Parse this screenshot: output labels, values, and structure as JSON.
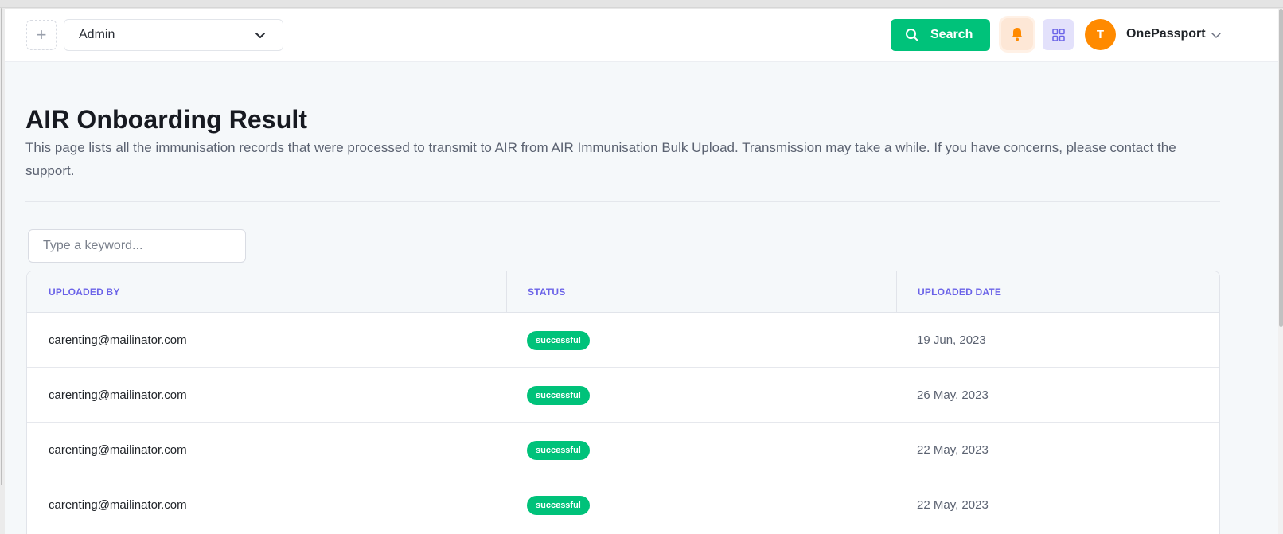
{
  "header": {
    "add_icon": "plus-icon",
    "role_select": {
      "value": "Admin",
      "icon": "chevron-down-icon"
    },
    "search_button": {
      "label": "Search",
      "icon": "search-icon",
      "color": "#00c27a"
    },
    "notifications": {
      "icon": "bell-icon",
      "color": "#ff8a00"
    },
    "apps": {
      "icon": "grid-icon",
      "color": "#6b63e8"
    },
    "user": {
      "initial": "T",
      "name": "OnePassport",
      "avatar_color": "#ff8a00",
      "icon": "chevron-down-icon"
    }
  },
  "page": {
    "title": "AIR Onboarding Result",
    "description": "This page lists all the immunisation records that were processed to transmit to AIR from AIR Immunisation Bulk Upload. Transmission may take a while. If you have concerns, please contact the support."
  },
  "search": {
    "placeholder": "Type a keyword..."
  },
  "table": {
    "columns": [
      "UPLOADED BY",
      "STATUS",
      "UPLOADED DATE"
    ],
    "header_color": "#6b63e8",
    "status_color": "#00c27a",
    "rows": [
      {
        "uploaded_by": "carenting@mailinator.com",
        "status": "successful",
        "uploaded_date": "19 Jun, 2023"
      },
      {
        "uploaded_by": "carenting@mailinator.com",
        "status": "successful",
        "uploaded_date": "26 May, 2023"
      },
      {
        "uploaded_by": "carenting@mailinator.com",
        "status": "successful",
        "uploaded_date": "22 May, 2023"
      },
      {
        "uploaded_by": "carenting@mailinator.com",
        "status": "successful",
        "uploaded_date": "22 May, 2023"
      }
    ]
  }
}
